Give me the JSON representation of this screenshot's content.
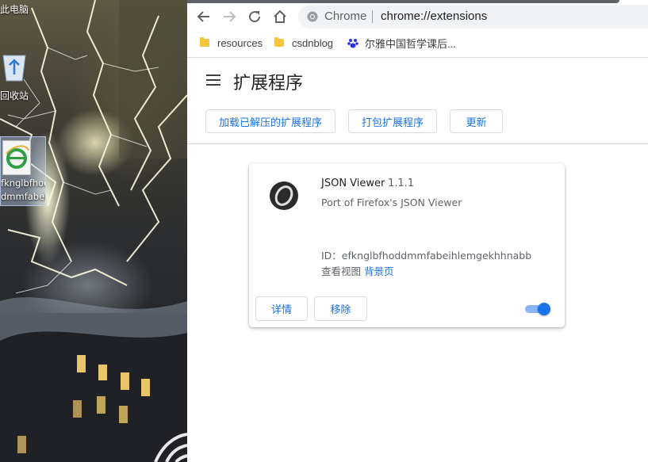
{
  "desktop": {
    "this_pc_label": "此电脑",
    "recycle_bin_label": "回收站",
    "file_icon_label_line1": "fknglbfhod",
    "file_icon_label_line2": "dmmfabeih..."
  },
  "browser": {
    "omnibox": {
      "scheme_label": "Chrome",
      "url": "chrome://extensions"
    },
    "bookmarks": [
      {
        "label": "resources",
        "icon": "folder-icon"
      },
      {
        "label": "csdnblog",
        "icon": "folder-icon"
      },
      {
        "label": "尔雅中国哲学课后...",
        "icon": "baidu-paw-icon"
      }
    ]
  },
  "extensions_page": {
    "title": "扩展程序",
    "toolbar": {
      "load_unpacked": "加载已解压的扩展程序",
      "pack_extension": "打包扩展程序",
      "update": "更新"
    },
    "card": {
      "name": "JSON Viewer",
      "version": "1.1.1",
      "description": "Port of Firefox's JSON Viewer",
      "id_line": "ID：efknglbfhoddmmfabeihlemgekhhnabb",
      "views_label": "查看视图",
      "views_link": "背景页",
      "details_button": "详情",
      "remove_button": "移除",
      "enabled": true
    }
  },
  "colors": {
    "accent": "#1a73e8",
    "toggle_track": "#8ab4f8",
    "folder": "#f6c63c"
  }
}
